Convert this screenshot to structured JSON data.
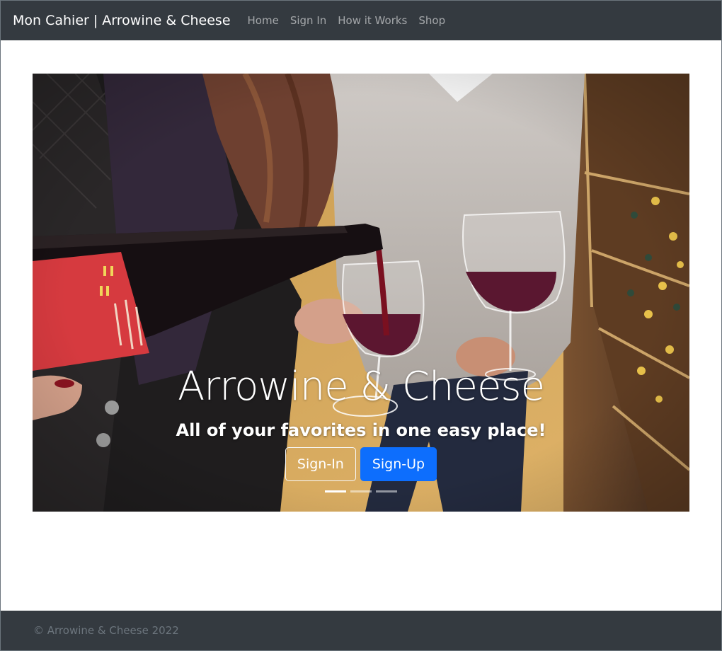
{
  "navbar": {
    "brand": "Mon Cahier | Arrowine & Cheese",
    "links": [
      "Home",
      "Sign In",
      "How it Works",
      "Shop"
    ]
  },
  "hero": {
    "title": "Arrowine & Cheese",
    "subtitle": "All of your favorites in one easy place!",
    "signin_label": "Sign-In",
    "signup_label": "Sign-Up",
    "slide_count": 3,
    "active_slide": 1
  },
  "footer": {
    "copyright": "© Arrowine & Cheese 2022"
  },
  "colors": {
    "navbar_bg": "#343a40",
    "primary": "#0d6efd",
    "footer_text": "#6c757d"
  }
}
